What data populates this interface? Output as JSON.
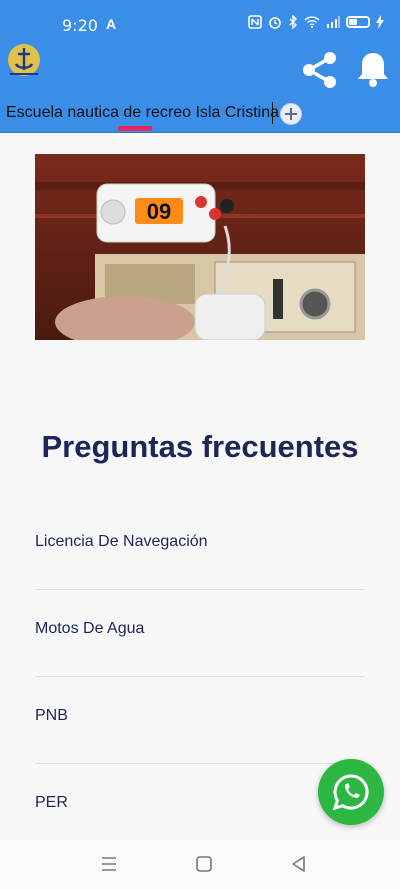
{
  "status_bar": {
    "time": "9:20",
    "indicator_a": "A",
    "icons": [
      "nfc-icon",
      "alarm-icon",
      "bluetooth-icon",
      "wifi-icon",
      "signal-icon",
      "battery-icon",
      "charging-icon"
    ],
    "battery_level": 0.5
  },
  "app_bar": {
    "logo": "escuela-nautica-logo",
    "actions": [
      "share-icon",
      "bell-icon"
    ],
    "color": "#3a8ee8"
  },
  "tabs": {
    "active_label": "Escuela nautica de recreo Isla Cristina",
    "indicator_color": "#e5275c",
    "add_icon": "plus-circle-icon"
  },
  "hero_image": {
    "subject": "marine VHF radio with microphone",
    "display_text": "09"
  },
  "faq": {
    "title": "Preguntas frecuentes",
    "items": [
      {
        "label": "Licencia De Navegación"
      },
      {
        "label": "Motos De Agua"
      },
      {
        "label": "PNB"
      },
      {
        "label": "PER"
      }
    ]
  },
  "fab": {
    "icon": "whatsapp-icon",
    "color": "#2bb741"
  },
  "system_nav": {
    "buttons": [
      "menu-icon",
      "home-icon",
      "back-icon"
    ]
  }
}
